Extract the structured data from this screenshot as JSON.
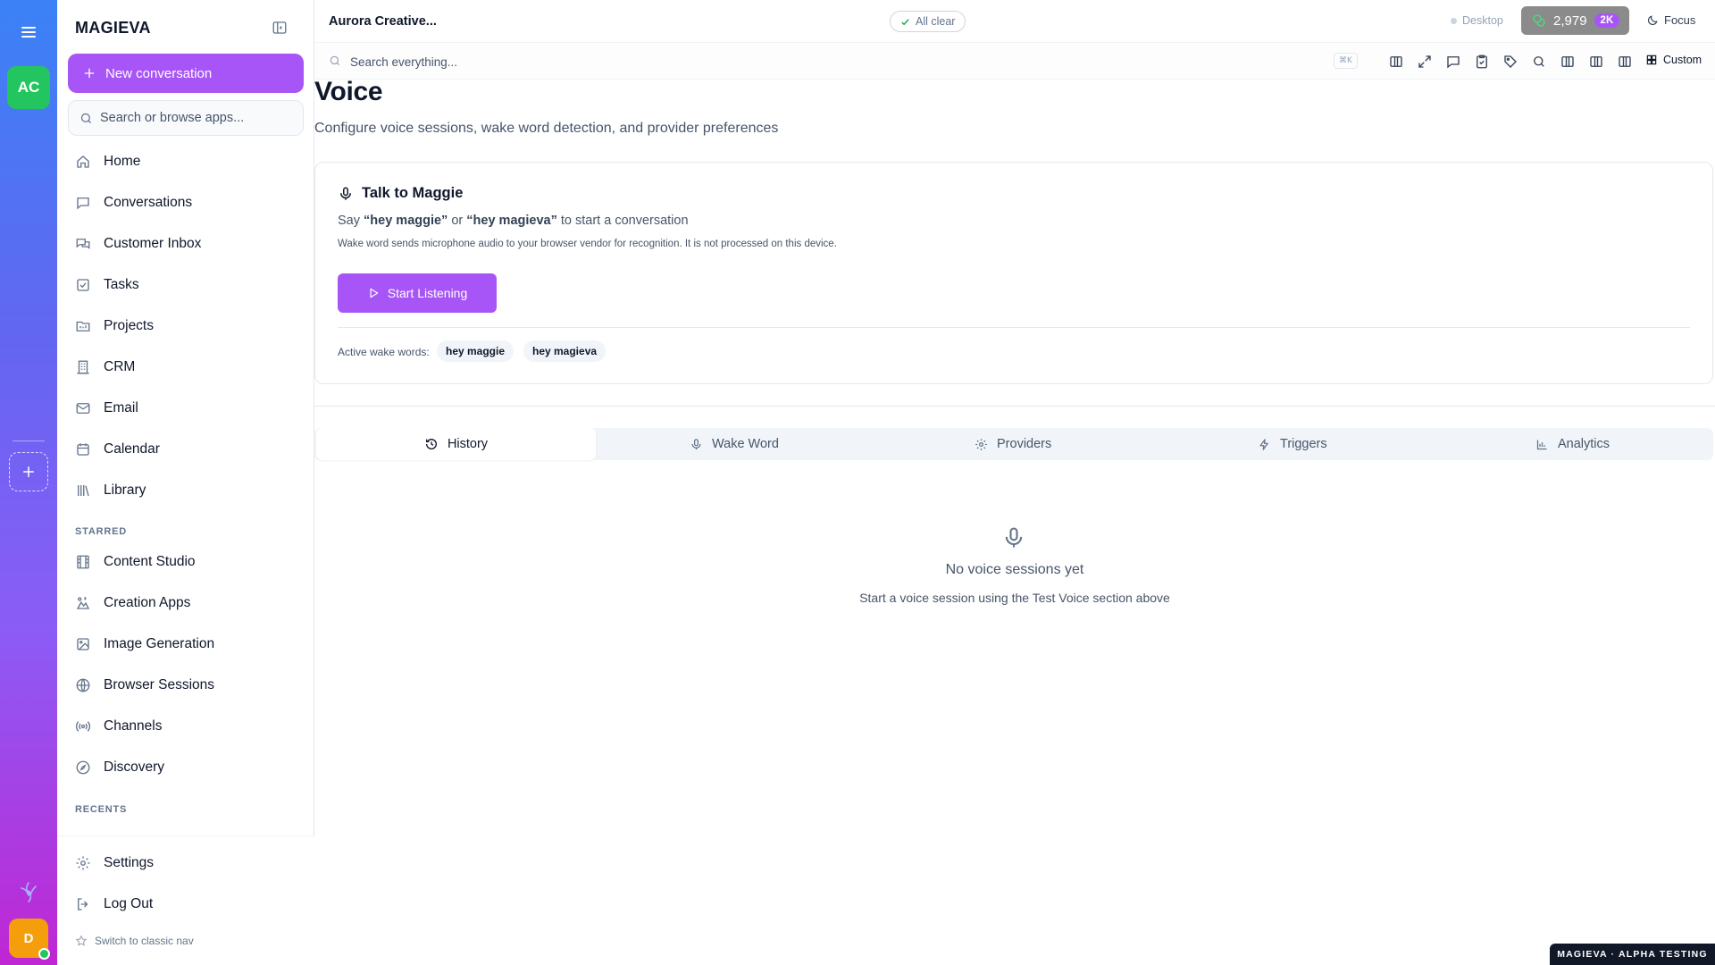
{
  "app": {
    "brand": "MAGIEVA",
    "workspace_initials": "AC",
    "user_initial": "D",
    "accent_color": "#a855f7"
  },
  "sidebar": {
    "new_conversation": "New conversation",
    "search_placeholder": "Search or browse apps...",
    "items": [
      {
        "label": "Home",
        "icon": "home-icon"
      },
      {
        "label": "Conversations",
        "icon": "chat-icon"
      },
      {
        "label": "Customer Inbox",
        "icon": "inbox-icon"
      },
      {
        "label": "Tasks",
        "icon": "check-square-icon"
      },
      {
        "label": "Projects",
        "icon": "folder-icon"
      },
      {
        "label": "CRM",
        "icon": "building-icon"
      },
      {
        "label": "Email",
        "icon": "mail-icon"
      },
      {
        "label": "Calendar",
        "icon": "calendar-icon"
      },
      {
        "label": "Library",
        "icon": "library-icon"
      }
    ],
    "starred_heading": "STARRED",
    "starred": [
      {
        "label": "Content Studio",
        "icon": "film-icon"
      },
      {
        "label": "Creation Apps",
        "icon": "apps-icon"
      },
      {
        "label": "Image Generation",
        "icon": "image-icon"
      },
      {
        "label": "Browser Sessions",
        "icon": "globe-icon"
      },
      {
        "label": "Channels",
        "icon": "broadcast-icon"
      },
      {
        "label": "Discovery",
        "icon": "compass-icon"
      }
    ],
    "recents_heading": "RECENTS",
    "settings": "Settings",
    "logout": "Log Out",
    "classic_nav": "Switch to classic nav"
  },
  "topbar": {
    "workspace_title": "Aurora Creative...",
    "status": "All clear",
    "device": "Desktop",
    "credits": "2,979",
    "credits_badge": "2K",
    "focus": "Focus"
  },
  "searchbar": {
    "placeholder": "Search everything...",
    "shortcut": "⌘K",
    "custom_label": "Custom"
  },
  "page": {
    "title": "Voice",
    "subtitle": "Configure voice sessions, wake word detection, and provider preferences"
  },
  "talk_card": {
    "title": "Talk to Maggie",
    "say_prefix": "Say",
    "wake1": "“hey maggie”",
    "say_or": "or",
    "wake2": "“hey magieva”",
    "say_suffix": "to start a conversation",
    "note": "Wake word sends microphone audio to your browser vendor for recognition. It is not processed on this device.",
    "button": "Start Listening",
    "active_label": "Active wake words:",
    "chips": [
      "hey maggie",
      "hey magieva"
    ]
  },
  "tabs": [
    {
      "label": "History",
      "icon": "history-icon",
      "active": true
    },
    {
      "label": "Wake Word",
      "icon": "mic-icon",
      "active": false
    },
    {
      "label": "Providers",
      "icon": "gear-icon",
      "active": false
    },
    {
      "label": "Triggers",
      "icon": "bolt-icon",
      "active": false
    },
    {
      "label": "Analytics",
      "icon": "bar-chart-icon",
      "active": false
    }
  ],
  "empty_state": {
    "title": "No voice sessions yet",
    "subtitle": "Start a voice session using the Test Voice section above"
  },
  "footer_badge": "MAGIEVA · ALPHA TESTING"
}
